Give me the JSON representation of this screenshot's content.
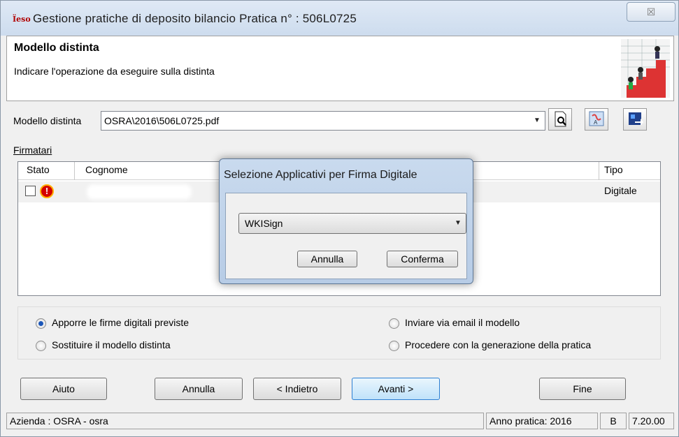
{
  "window": {
    "title": "Gestione pratiche di deposito bilancio Pratica n° :  506L0725",
    "app_icon_text": "Ïeso",
    "close_glyph": "☒"
  },
  "header": {
    "title": "Modello distinta",
    "subtitle": "Indicare l'operazione da eseguire sulla distinta"
  },
  "modello": {
    "label": "Modello distinta",
    "value": "OSRA\\2016\\506L0725.pdf"
  },
  "firmatari": {
    "label": "Firmatari",
    "columns": [
      "Stato",
      "Cognome",
      "Tipo"
    ],
    "rows": [
      {
        "tipo": "Digitale",
        "status_icon": "warning-icon"
      }
    ]
  },
  "options": {
    "apporre": "Apporre le firme digitali previste",
    "sostituire": "Sostituire il modello distinta",
    "inviare": "Inviare via email il modello",
    "procedere": "Procedere con la generazione della pratica",
    "selected": "apporre"
  },
  "buttons": {
    "aiuto": "Aiuto",
    "annulla": "Annulla",
    "indietro": "< Indietro",
    "avanti": "Avanti >",
    "fine": "Fine"
  },
  "statusbar": {
    "azienda": "Azienda : OSRA - osra",
    "anno": "Anno pratica: 2016",
    "code": "B",
    "version": "7.20.00"
  },
  "dialog": {
    "title": "Selezione Applicativi per Firma Digitale",
    "selected": "WKISign",
    "annulla": "Annulla",
    "conferma": "Conferma"
  },
  "colors": {
    "accent": "#2c7fd3",
    "warning": "#d40000",
    "radio_on": "#1b56b8"
  }
}
